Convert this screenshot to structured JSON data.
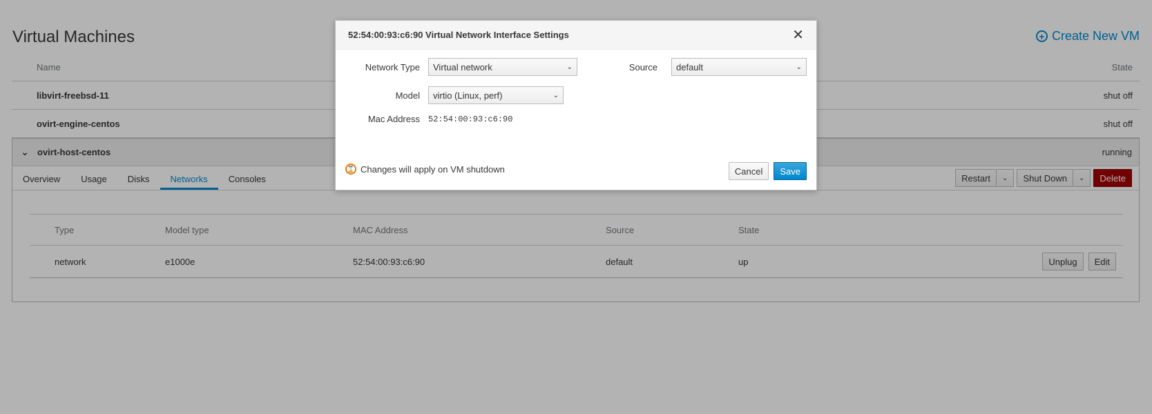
{
  "page": {
    "title": "Virtual Machines",
    "create_label": "Create New VM"
  },
  "vm_table": {
    "headers": {
      "name": "Name",
      "state": "State"
    },
    "rows": [
      {
        "name": "libvirt-freebsd-11",
        "state": "shut off"
      },
      {
        "name": "ovirt-engine-centos",
        "state": "shut off"
      },
      {
        "name": "ovirt-host-centos",
        "state": "running"
      }
    ]
  },
  "vm_detail": {
    "tabs": [
      "Overview",
      "Usage",
      "Disks",
      "Networks",
      "Consoles"
    ],
    "active_tab": "Networks",
    "actions": {
      "restart": "Restart",
      "shutdown": "Shut Down",
      "delete": "Delete"
    }
  },
  "network_table": {
    "headers": {
      "type": "Type",
      "model": "Model type",
      "mac": "MAC Address",
      "source": "Source",
      "state": "State"
    },
    "rows": [
      {
        "type": "network",
        "model": "e1000e",
        "mac": "52:54:00:93:c6:90",
        "source": "default",
        "state": "up",
        "unplug": "Unplug",
        "edit": "Edit"
      }
    ]
  },
  "modal": {
    "title": "52:54:00:93:c6:90 Virtual Network Interface Settings",
    "close_icon": "close-icon",
    "network_type": {
      "label": "Network Type",
      "value": "Virtual network"
    },
    "source": {
      "label": "Source",
      "value": "default"
    },
    "model": {
      "label": "Model",
      "value": "virtio (Linux, perf)"
    },
    "mac": {
      "label": "Mac Address",
      "value": "52:54:00:93:c6:90"
    },
    "note": "Changes will apply on VM shutdown",
    "cancel": "Cancel",
    "save": "Save"
  },
  "colors": {
    "accent": "#0088ce",
    "danger": "#a30000",
    "pending": "#ec7a08"
  }
}
